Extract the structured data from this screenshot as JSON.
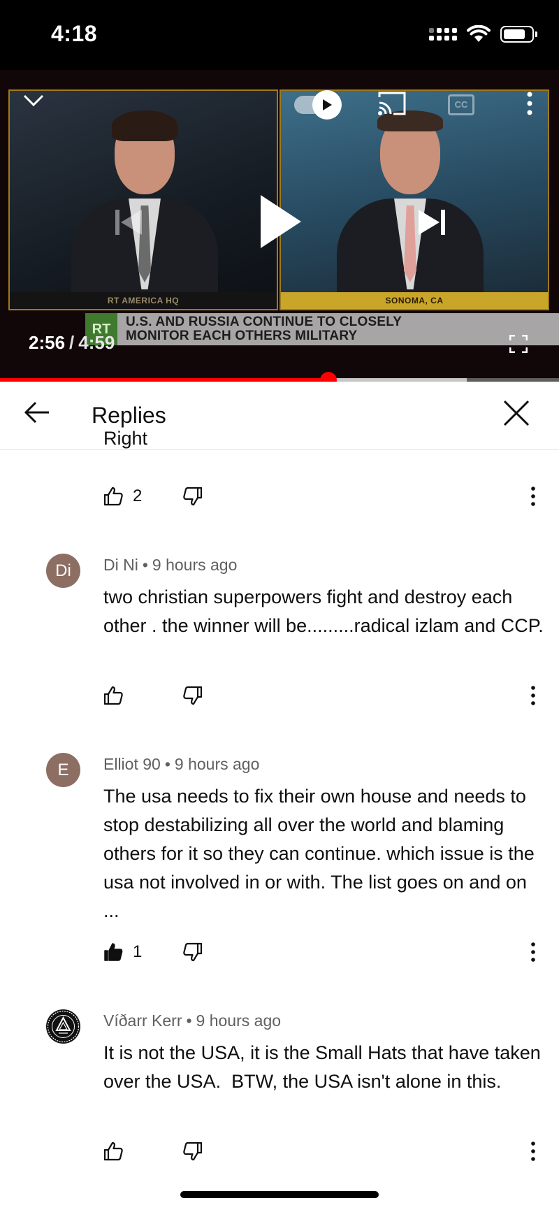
{
  "status_bar": {
    "time": "4:18"
  },
  "player": {
    "feed_left_label": "RT AMERICA HQ",
    "feed_right_label": "SONOMA, CA",
    "channel_logo": "RT",
    "headline_line1": "U.S. AND RUSSIA CONTINUE TO CLOSELY",
    "headline_line2": "MONITOR EACH OTHERS MILITARY",
    "current_time": "2:56",
    "separator": "/",
    "duration": "4:59",
    "cc_label": "CC",
    "progress_fraction": 0.587,
    "buffered_fraction": 0.835,
    "accent_color": "#ff0000"
  },
  "replies": {
    "title": "Replies",
    "back_icon": "arrow-left-icon",
    "close_icon": "close-icon"
  },
  "comments": [
    {
      "text": "Right",
      "likes": "2"
    },
    {
      "avatar_text": "Di",
      "author": "Di Ni",
      "time": "9 hours ago",
      "text": "two christian superpowers fight and destroy each other . the winner will be.........radical izlam and CCP.",
      "likes": ""
    },
    {
      "avatar_text": "E",
      "author": "Elliot 90",
      "time": "9 hours ago",
      "text": "The usa needs to fix their own house and needs to stop destabilizing all over the world and blaming others for it so they can continue. which issue is the usa not involved in or with. The list goes on and on ...",
      "likes": "1",
      "liked": true
    },
    {
      "avatar_text": "",
      "author": "Víðarr Kerr",
      "time": "9 hours ago",
      "text": "It is not the USA, it is the Small Hats that have taken over the USA.  BTW, the USA isn't alone in this.",
      "likes": ""
    }
  ],
  "dot_separator": "•"
}
